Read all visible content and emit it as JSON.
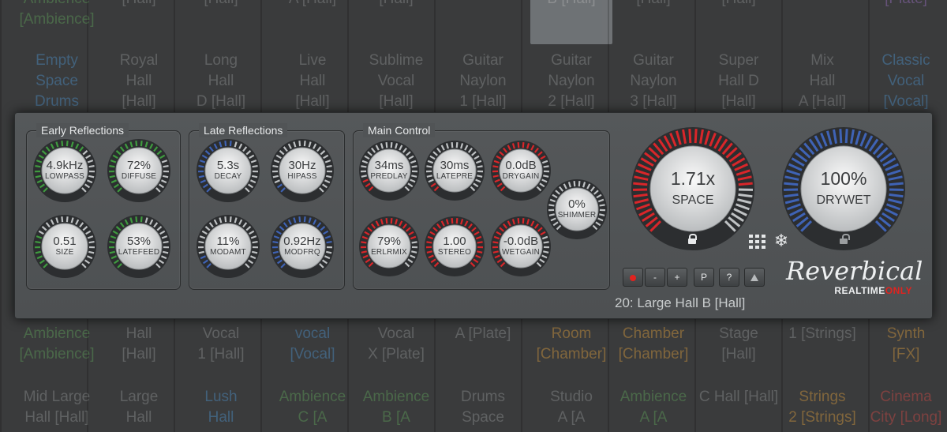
{
  "background": {
    "presets": [
      {
        "text": "Ambience\n[Ambience]",
        "color": "green",
        "col": 0,
        "row": 0
      },
      {
        "text": "[Hall]",
        "color": "gray",
        "col": 1,
        "row": 0
      },
      {
        "text": "[Hall]",
        "color": "gray",
        "col": 2,
        "row": 0
      },
      {
        "text": "A [Hall]",
        "color": "gray",
        "col": 3,
        "row": 0
      },
      {
        "text": "[Hall]",
        "color": "gray",
        "col": 4,
        "row": 0
      },
      {
        "text": "B [Hall]",
        "color": "gray",
        "col": 6,
        "row": 0,
        "selected": true
      },
      {
        "text": "[Hall]",
        "color": "gray",
        "col": 7,
        "row": 0
      },
      {
        "text": "[Hall]",
        "color": "gray",
        "col": 8,
        "row": 0
      },
      {
        "text": "[Plate]",
        "color": "purple",
        "col": 10,
        "row": 0
      },
      {
        "text": "Empty\nSpace\nDrums",
        "color": "blue",
        "col": 0,
        "row": 1
      },
      {
        "text": "Royal\nHall\n[Hall]",
        "color": "gray",
        "col": 1,
        "row": 1
      },
      {
        "text": "Long\nHall\nD [Hall]",
        "color": "gray",
        "col": 2,
        "row": 1
      },
      {
        "text": "Live\nHall\n[Hall]",
        "color": "gray",
        "col": 3,
        "row": 1
      },
      {
        "text": "Sublime\nVocal\n[Hall]",
        "color": "gray",
        "col": 4,
        "row": 1
      },
      {
        "text": "Guitar\nNaylon\n1 [Hall]",
        "color": "gray",
        "col": 5,
        "row": 1
      },
      {
        "text": "Guitar\nNaylon\n2 [Hall]",
        "color": "gray",
        "col": 6,
        "row": 1
      },
      {
        "text": "Guitar\nNaylon\n3 [Hall]",
        "color": "gray",
        "col": 7,
        "row": 1
      },
      {
        "text": "Super\nHall D\n[Hall]",
        "color": "gray",
        "col": 8,
        "row": 1
      },
      {
        "text": "Mix\nHall\nA [Hall]",
        "color": "gray",
        "col": 9,
        "row": 1
      },
      {
        "text": "Classic\nVocal\n[Vocal]",
        "color": "blue",
        "col": 10,
        "row": 1
      },
      {
        "text": "Ambience\n[Ambience]",
        "color": "green",
        "col": 0,
        "row": 2
      },
      {
        "text": "Hall\n[Hall]",
        "color": "gray",
        "col": 1,
        "row": 2
      },
      {
        "text": "Vocal\n1 [Hall]",
        "color": "gray",
        "col": 2,
        "row": 2
      },
      {
        "text": "vocal\n[Vocal]",
        "color": "blue",
        "col": 3,
        "row": 2
      },
      {
        "text": "Vocal\nX [Plate]",
        "color": "gray",
        "col": 4,
        "row": 2
      },
      {
        "text": "A [Plate]",
        "color": "gray",
        "col": 5,
        "row": 2
      },
      {
        "text": "Room\n[Chamber]",
        "color": "orange",
        "col": 6,
        "row": 2
      },
      {
        "text": "Chamber\n[Chamber]",
        "color": "orange",
        "col": 7,
        "row": 2
      },
      {
        "text": "Stage\n[Hall]",
        "color": "gray",
        "col": 8,
        "row": 2
      },
      {
        "text": "1 [Strings]",
        "color": "gray",
        "col": 9,
        "row": 2
      },
      {
        "text": "Synth\n[FX]",
        "color": "orange",
        "col": 10,
        "row": 2
      },
      {
        "text": "Mid Large\nHall [Hall]",
        "color": "gray",
        "col": 0,
        "row": 3
      },
      {
        "text": "Large\nHall",
        "color": "gray",
        "col": 1,
        "row": 3
      },
      {
        "text": "Lush\nHall",
        "color": "blue",
        "col": 2,
        "row": 3
      },
      {
        "text": "Ambience\nC [A",
        "color": "green",
        "col": 3,
        "row": 3
      },
      {
        "text": "Ambience\nB [A",
        "color": "green",
        "col": 4,
        "row": 3
      },
      {
        "text": "Drums\nSpace",
        "color": "gray",
        "col": 5,
        "row": 3
      },
      {
        "text": "Studio\nA [A",
        "color": "gray",
        "col": 6,
        "row": 3
      },
      {
        "text": "Ambience\nA [A",
        "color": "green",
        "col": 7,
        "row": 3
      },
      {
        "text": "C Hall [Hall]",
        "color": "gray",
        "col": 8,
        "row": 3
      },
      {
        "text": "Strings\n2 [Strings]",
        "color": "orange",
        "col": 9,
        "row": 3
      },
      {
        "text": "Cinema\nCity [Long]",
        "color": "red",
        "col": 10,
        "row": 3
      }
    ]
  },
  "colors": {
    "green": "#3f9b3f",
    "blue": "#3f63b5",
    "red": "#d9262a",
    "track": "#bfc2c4",
    "accent_red": "#e0231f"
  },
  "groups": {
    "early": {
      "title": "Early Reflections"
    },
    "late": {
      "title": "Late Reflections"
    },
    "main": {
      "title": "Main Control"
    }
  },
  "knobs": {
    "lowpass": {
      "value": "4.9kHz",
      "label": "LOWPASS",
      "color": "green",
      "level": 0.65
    },
    "diffuse": {
      "value": "72%",
      "label": "DIFFUSE",
      "color": "green",
      "level": 0.72
    },
    "size": {
      "value": "0.51",
      "label": "SIZE",
      "color": "green",
      "level": 0.25
    },
    "latefeed": {
      "value": "53%",
      "label": "LATEFEED",
      "color": "green",
      "level": 0.53
    },
    "decay": {
      "value": "5.3s",
      "label": "DECAY",
      "color": "blue",
      "level": 0.55
    },
    "hipass": {
      "value": "30Hz",
      "label": "HIPASS",
      "color": "blue",
      "level": 0.05
    },
    "modamt": {
      "value": "11%",
      "label": "MODAMT",
      "color": "blue",
      "level": 0.11
    },
    "modfrq": {
      "value": "0.92Hz",
      "label": "MODFRQ",
      "color": "blue",
      "level": 0.8
    },
    "predlay": {
      "value": "34ms",
      "label": "PREDLAY",
      "color": "red",
      "level": 0.08
    },
    "latepre": {
      "value": "30ms",
      "label": "LATEPRE",
      "color": "red",
      "level": 0.06
    },
    "drygain": {
      "value": "0.0dB",
      "label": "DRYGAIN",
      "color": "red",
      "level": 0.75
    },
    "shimmer": {
      "value": "0%",
      "label": "SHIMMER",
      "color": "red",
      "level": 0.0
    },
    "erlrmix": {
      "value": "79%",
      "label": "ERLRMIX",
      "color": "red",
      "level": 0.79
    },
    "stereo": {
      "value": "1.00",
      "label": "STEREO",
      "color": "red",
      "level": 1.0
    },
    "wetgain": {
      "value": "-0.0dB",
      "label": "WETGAIN",
      "color": "red",
      "level": 0.74
    },
    "space": {
      "value": "1.71x",
      "label": "SPACE",
      "color": "red",
      "level": 0.82
    },
    "drywet": {
      "value": "100%",
      "label": "DRYWET",
      "color": "blue",
      "level": 1.0
    }
  },
  "buttons": {
    "record": {
      "icon": "record-dot-icon"
    },
    "minus": {
      "label": "-"
    },
    "plus": {
      "label": "+"
    },
    "p": {
      "label": "P"
    },
    "help": {
      "label": "?"
    },
    "up": {
      "icon": "triangle-up-icon"
    }
  },
  "preset": {
    "name": "20: Large Hall B [Hall]"
  },
  "brand": {
    "name": "Reverbical",
    "sub_main": "REALTIME",
    "sub_accent": "ONLY"
  },
  "icons": {
    "grid": "grid-icon",
    "snow": "snowflake-icon",
    "snow_glyph": "❄",
    "lock": "lock-icon"
  }
}
